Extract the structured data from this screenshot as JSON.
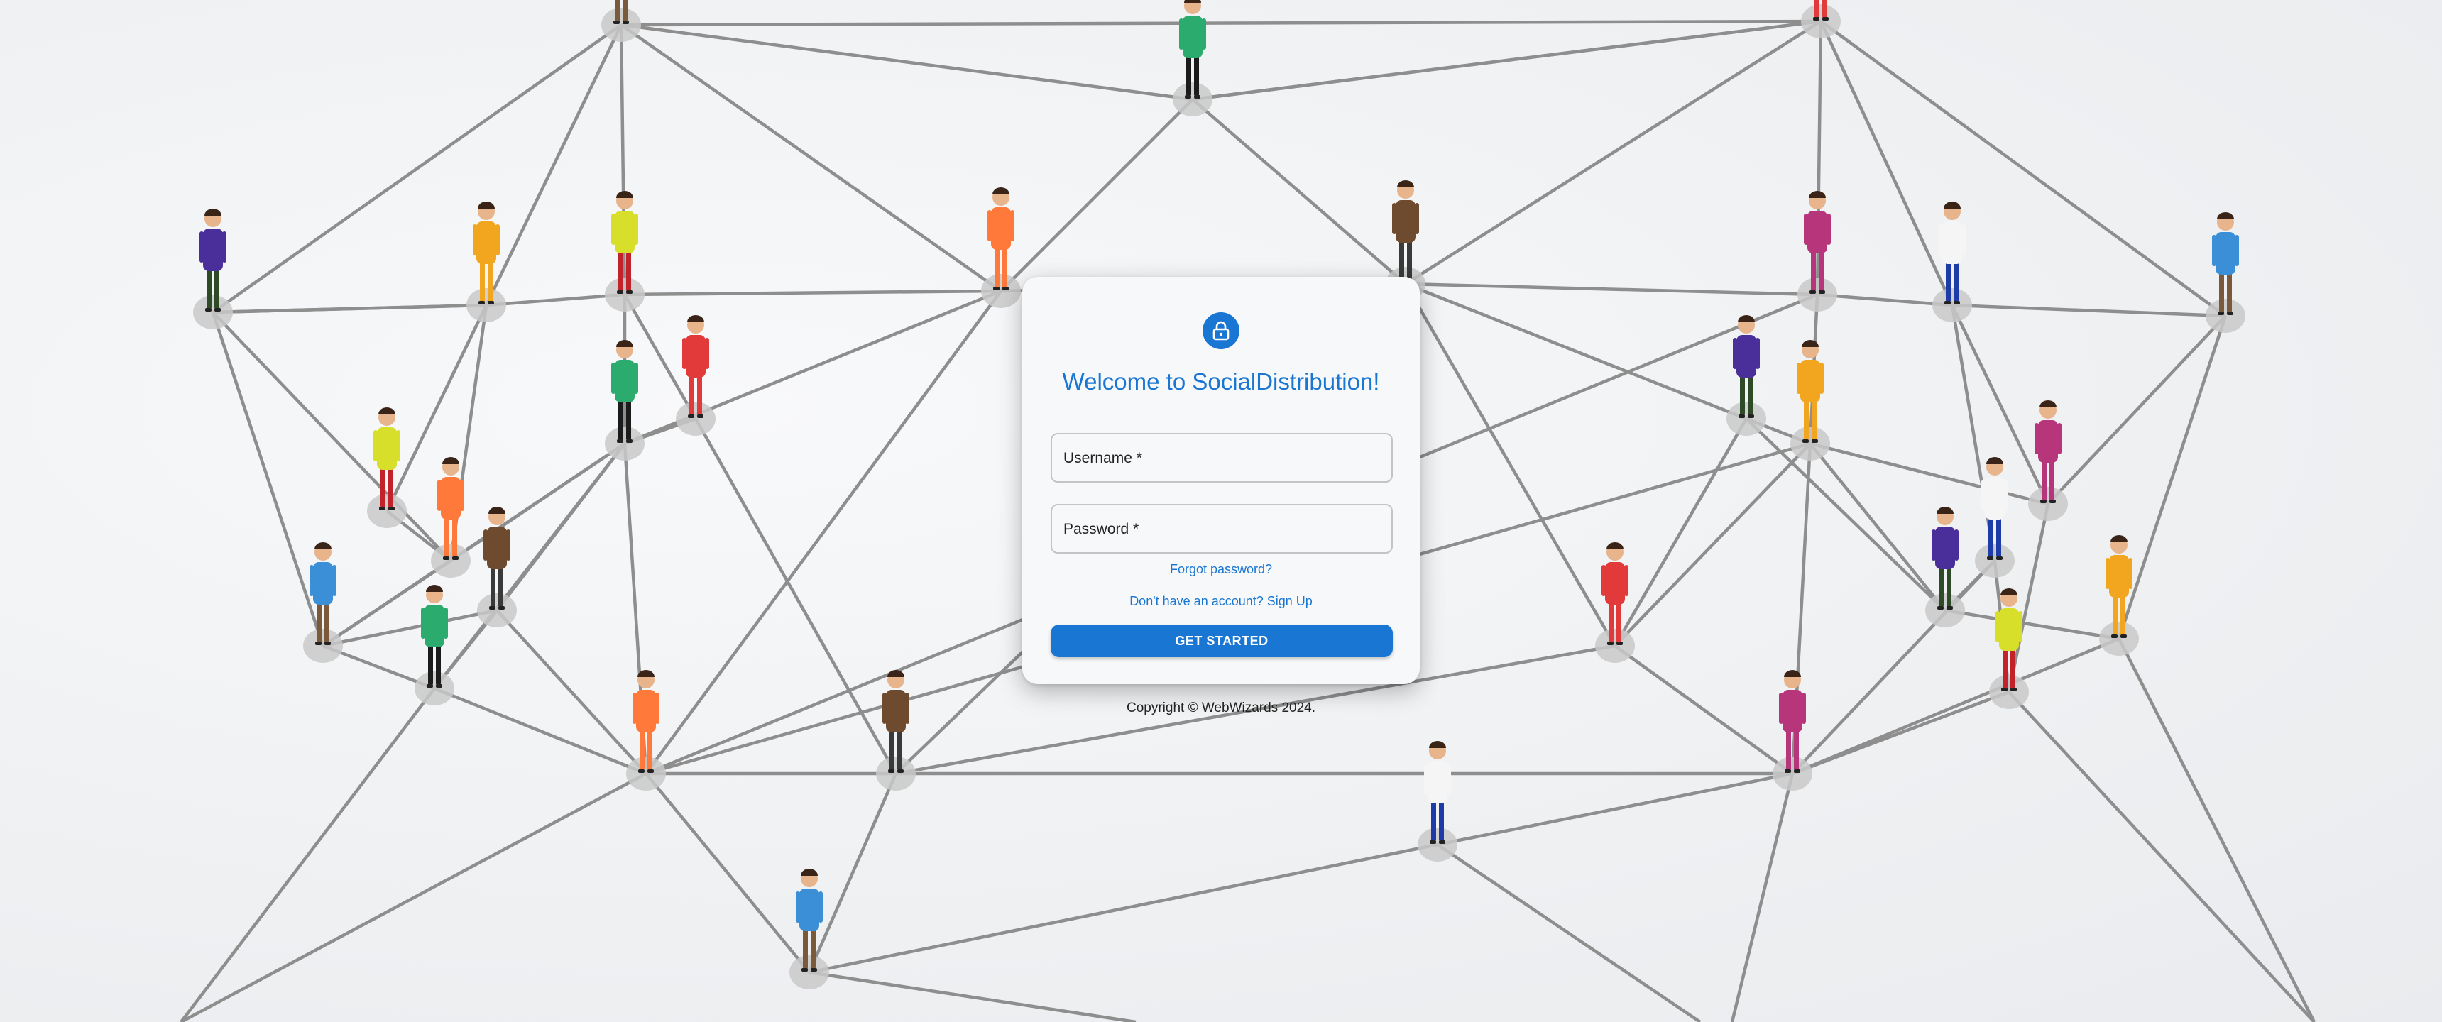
{
  "login": {
    "title": "Welcome to SocialDistribution!",
    "username_label": "Username *",
    "username_value": "",
    "password_label": "Password *",
    "password_value": "",
    "forgot_password": "Forgot password?",
    "signup_link": "Don't have an account? Sign Up",
    "submit_label": "GET STARTED"
  },
  "footer": {
    "prefix": "Copyright © ",
    "brand": "WebWizards",
    "suffix": " 2024."
  },
  "colors": {
    "accent": "#1976d2",
    "card_background": "#f7f8f9",
    "network_lines": "#8e8e8e"
  },
  "icons": {
    "avatar": "lock-icon",
    "background_people": "person-figure-icon"
  }
}
